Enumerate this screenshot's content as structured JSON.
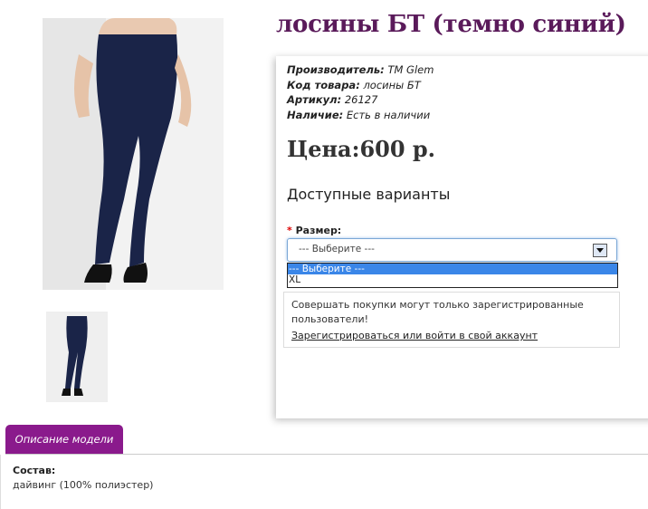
{
  "product": {
    "title": "лосины БТ (темно синий)",
    "manufacturer_label": "Производитель:",
    "manufacturer": "TM Glem",
    "code_label": "Код товара:",
    "code": "лосины БТ",
    "article_label": "Артикул:",
    "article": "26127",
    "availability_label": "Наличие:",
    "availability": "Есть в наличии",
    "price": "Цена:600 р."
  },
  "options": {
    "heading": "Доступные варианты",
    "required_mark": "*",
    "size_label": "Размер:",
    "select_value": "--- Выберите ---",
    "dropdown": [
      "--- Выберите ---",
      "XL"
    ]
  },
  "notice": {
    "text": "Совершать покупки могут только зарегистрированные пользователи!",
    "link": "Зарегистрироваться или войти в свой аккаунт"
  },
  "description": {
    "tab": "Описание модели",
    "composition_label": "Состав:",
    "composition": "дайвинг (100% полиэстер)"
  },
  "colors": {
    "title": "#5a1a5a",
    "tab": "#8a1a8c",
    "leggings": "#1a2448"
  }
}
